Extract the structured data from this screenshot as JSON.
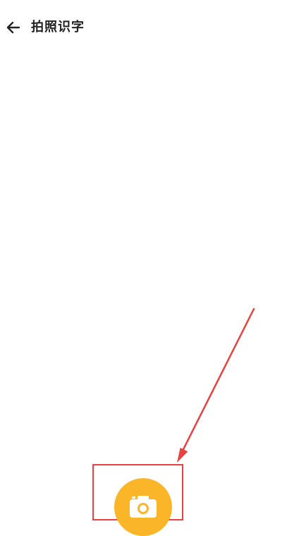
{
  "header": {
    "title": "拍照识字",
    "back_icon": "arrow-left-icon"
  },
  "capture": {
    "icon": "camera-icon"
  },
  "colors": {
    "background": "#ffffff",
    "title_text": "#222222",
    "annotation_red": "#e8413f",
    "camera_button": "#fbb528"
  }
}
